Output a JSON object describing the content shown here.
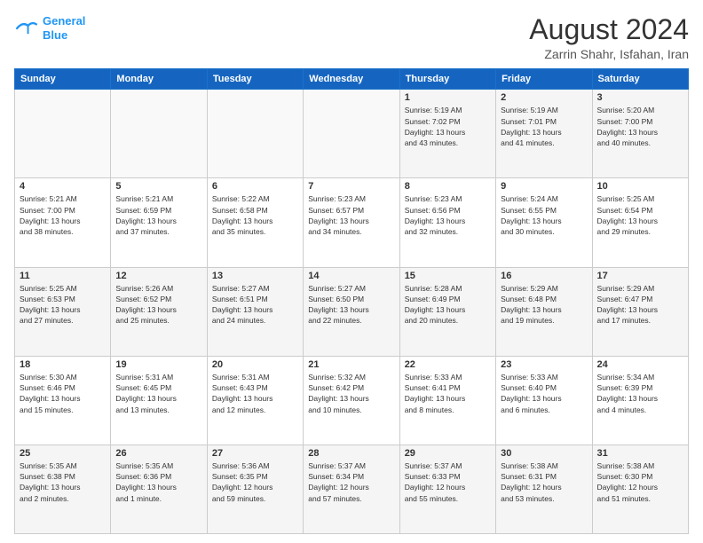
{
  "header": {
    "logo_line1": "General",
    "logo_line2": "Blue",
    "month_year": "August 2024",
    "location": "Zarrin Shahr, Isfahan, Iran"
  },
  "weekdays": [
    "Sunday",
    "Monday",
    "Tuesday",
    "Wednesday",
    "Thursday",
    "Friday",
    "Saturday"
  ],
  "weeks": [
    [
      {
        "day": "",
        "info": ""
      },
      {
        "day": "",
        "info": ""
      },
      {
        "day": "",
        "info": ""
      },
      {
        "day": "",
        "info": ""
      },
      {
        "day": "1",
        "info": "Sunrise: 5:19 AM\nSunset: 7:02 PM\nDaylight: 13 hours\nand 43 minutes."
      },
      {
        "day": "2",
        "info": "Sunrise: 5:19 AM\nSunset: 7:01 PM\nDaylight: 13 hours\nand 41 minutes."
      },
      {
        "day": "3",
        "info": "Sunrise: 5:20 AM\nSunset: 7:00 PM\nDaylight: 13 hours\nand 40 minutes."
      }
    ],
    [
      {
        "day": "4",
        "info": "Sunrise: 5:21 AM\nSunset: 7:00 PM\nDaylight: 13 hours\nand 38 minutes."
      },
      {
        "day": "5",
        "info": "Sunrise: 5:21 AM\nSunset: 6:59 PM\nDaylight: 13 hours\nand 37 minutes."
      },
      {
        "day": "6",
        "info": "Sunrise: 5:22 AM\nSunset: 6:58 PM\nDaylight: 13 hours\nand 35 minutes."
      },
      {
        "day": "7",
        "info": "Sunrise: 5:23 AM\nSunset: 6:57 PM\nDaylight: 13 hours\nand 34 minutes."
      },
      {
        "day": "8",
        "info": "Sunrise: 5:23 AM\nSunset: 6:56 PM\nDaylight: 13 hours\nand 32 minutes."
      },
      {
        "day": "9",
        "info": "Sunrise: 5:24 AM\nSunset: 6:55 PM\nDaylight: 13 hours\nand 30 minutes."
      },
      {
        "day": "10",
        "info": "Sunrise: 5:25 AM\nSunset: 6:54 PM\nDaylight: 13 hours\nand 29 minutes."
      }
    ],
    [
      {
        "day": "11",
        "info": "Sunrise: 5:25 AM\nSunset: 6:53 PM\nDaylight: 13 hours\nand 27 minutes."
      },
      {
        "day": "12",
        "info": "Sunrise: 5:26 AM\nSunset: 6:52 PM\nDaylight: 13 hours\nand 25 minutes."
      },
      {
        "day": "13",
        "info": "Sunrise: 5:27 AM\nSunset: 6:51 PM\nDaylight: 13 hours\nand 24 minutes."
      },
      {
        "day": "14",
        "info": "Sunrise: 5:27 AM\nSunset: 6:50 PM\nDaylight: 13 hours\nand 22 minutes."
      },
      {
        "day": "15",
        "info": "Sunrise: 5:28 AM\nSunset: 6:49 PM\nDaylight: 13 hours\nand 20 minutes."
      },
      {
        "day": "16",
        "info": "Sunrise: 5:29 AM\nSunset: 6:48 PM\nDaylight: 13 hours\nand 19 minutes."
      },
      {
        "day": "17",
        "info": "Sunrise: 5:29 AM\nSunset: 6:47 PM\nDaylight: 13 hours\nand 17 minutes."
      }
    ],
    [
      {
        "day": "18",
        "info": "Sunrise: 5:30 AM\nSunset: 6:46 PM\nDaylight: 13 hours\nand 15 minutes."
      },
      {
        "day": "19",
        "info": "Sunrise: 5:31 AM\nSunset: 6:45 PM\nDaylight: 13 hours\nand 13 minutes."
      },
      {
        "day": "20",
        "info": "Sunrise: 5:31 AM\nSunset: 6:43 PM\nDaylight: 13 hours\nand 12 minutes."
      },
      {
        "day": "21",
        "info": "Sunrise: 5:32 AM\nSunset: 6:42 PM\nDaylight: 13 hours\nand 10 minutes."
      },
      {
        "day": "22",
        "info": "Sunrise: 5:33 AM\nSunset: 6:41 PM\nDaylight: 13 hours\nand 8 minutes."
      },
      {
        "day": "23",
        "info": "Sunrise: 5:33 AM\nSunset: 6:40 PM\nDaylight: 13 hours\nand 6 minutes."
      },
      {
        "day": "24",
        "info": "Sunrise: 5:34 AM\nSunset: 6:39 PM\nDaylight: 13 hours\nand 4 minutes."
      }
    ],
    [
      {
        "day": "25",
        "info": "Sunrise: 5:35 AM\nSunset: 6:38 PM\nDaylight: 13 hours\nand 2 minutes."
      },
      {
        "day": "26",
        "info": "Sunrise: 5:35 AM\nSunset: 6:36 PM\nDaylight: 13 hours\nand 1 minute."
      },
      {
        "day": "27",
        "info": "Sunrise: 5:36 AM\nSunset: 6:35 PM\nDaylight: 12 hours\nand 59 minutes."
      },
      {
        "day": "28",
        "info": "Sunrise: 5:37 AM\nSunset: 6:34 PM\nDaylight: 12 hours\nand 57 minutes."
      },
      {
        "day": "29",
        "info": "Sunrise: 5:37 AM\nSunset: 6:33 PM\nDaylight: 12 hours\nand 55 minutes."
      },
      {
        "day": "30",
        "info": "Sunrise: 5:38 AM\nSunset: 6:31 PM\nDaylight: 12 hours\nand 53 minutes."
      },
      {
        "day": "31",
        "info": "Sunrise: 5:38 AM\nSunset: 6:30 PM\nDaylight: 12 hours\nand 51 minutes."
      }
    ]
  ]
}
